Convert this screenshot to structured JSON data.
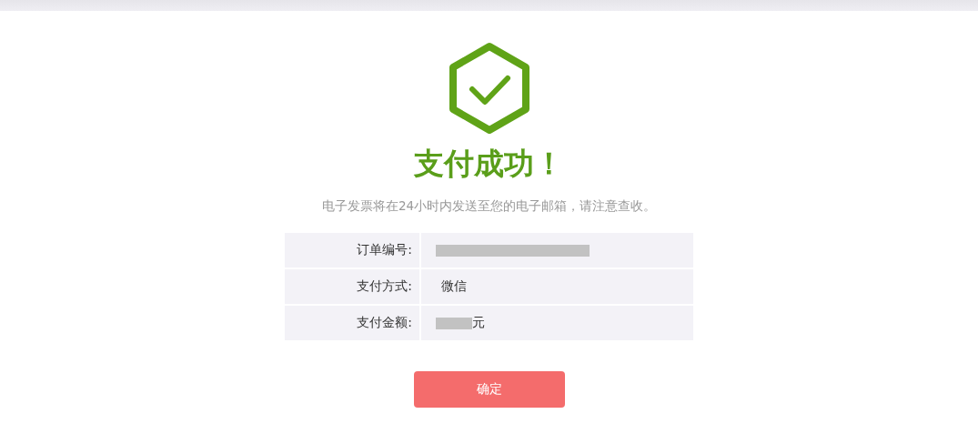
{
  "result": {
    "title": "支付成功！",
    "message": "电子发票将在24小时内发送至您的电子邮箱，请注意查收。"
  },
  "details": [
    {
      "label": "订单编号:",
      "redacted": true
    },
    {
      "label": "支付方式:",
      "redacted": false,
      "value": "微信"
    },
    {
      "label": "支付金额:",
      "redacted": true,
      "suffix": "元"
    }
  ],
  "confirm_button": "确定"
}
